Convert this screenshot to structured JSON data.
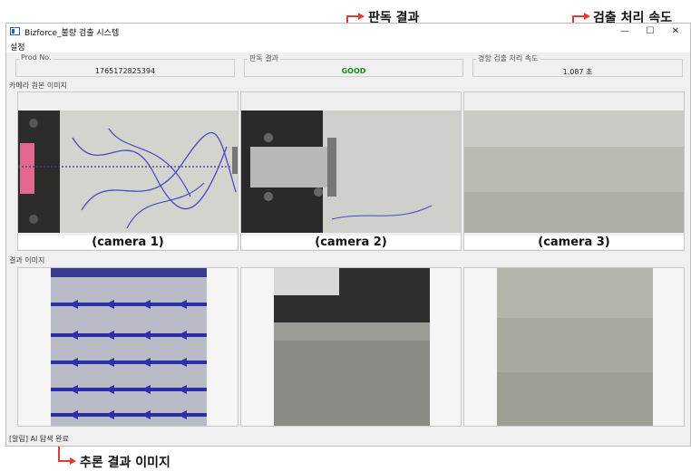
{
  "annotations": {
    "judgement": "판독 결과",
    "speed": "검출 처리 속도",
    "inference": "추론 결과 이미지"
  },
  "window": {
    "title": "Bizforce_불량 검출 시스템",
    "minimize": "—",
    "maximize": "☐",
    "close": "✕"
  },
  "menu": {
    "settings": "설정"
  },
  "info": {
    "prod_label": "Prod No.",
    "prod_value": "1765172825394",
    "result_label": "판독 결과",
    "result_value": "GOOD",
    "speed_label": "경함 검출 처리 속도",
    "speed_value": "1.087 초"
  },
  "camera_section": {
    "label": "카메라 원본 이미지",
    "captions": [
      "(camera 1)",
      "(camera 2)",
      "(camera 3)"
    ]
  },
  "result_section": {
    "label": "결과 이미지"
  },
  "status": {
    "text": "[알림] AI 탐색 완료"
  },
  "colors": {
    "good": "#1b8a1b",
    "annotation": "#e53935",
    "detection": "#2e2ea8"
  }
}
